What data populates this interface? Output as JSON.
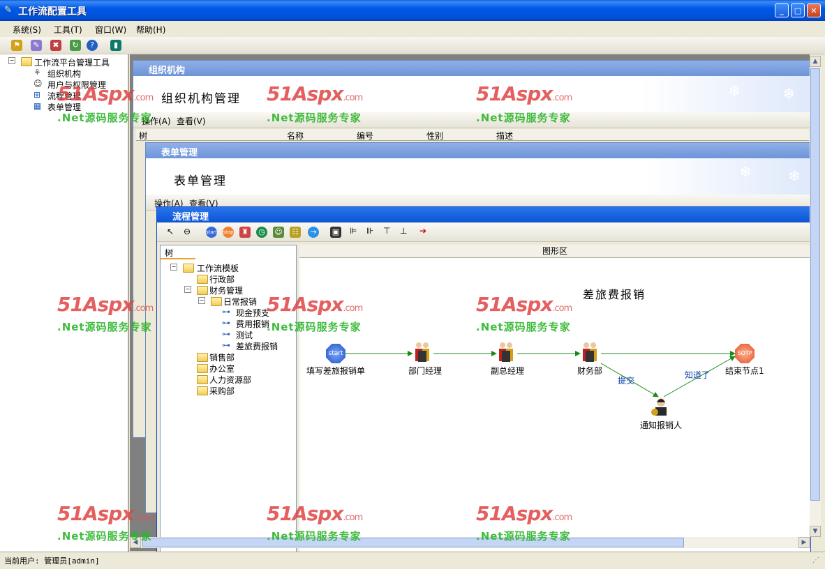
{
  "window": {
    "title": "工作流配置工具"
  },
  "menu": [
    "系统(S)",
    "工具(T)",
    "窗口(W)",
    "帮助(H)"
  ],
  "tree": {
    "root": "工作流平台管理工具",
    "items": [
      "组织机构",
      "用户与权限管理",
      "流程管理",
      "表单管理"
    ]
  },
  "org_window": {
    "title": "组织机构",
    "banner": "组织机构管理",
    "toolbar": {
      "operate": "操作(A)",
      "view": "查看(V)"
    },
    "tab": "树",
    "columns": [
      "名称",
      "编号",
      "性别",
      "描述"
    ]
  },
  "form_window": {
    "title": "表单管理",
    "banner": "表单管理",
    "toolbar": {
      "operate": "操作(A)",
      "view": "查看(V)"
    }
  },
  "flow_window": {
    "title": "流程管理",
    "tab_tree": "树",
    "tab_graph": "图形区",
    "tree": {
      "root": "工作流模板",
      "depts": [
        "行政部",
        "财务管理",
        "销售部",
        "办公室",
        "人力资源部",
        "采购部"
      ],
      "sub": "日常报销",
      "templates": [
        "现金预支",
        "费用报销",
        "测试",
        "差旅费报销"
      ]
    },
    "diagram": {
      "title": "差旅费报销",
      "nodes": [
        "填写差旅报销单",
        "部门经理",
        "副总经理",
        "财务部",
        "结束节点1",
        "通知报销人"
      ],
      "edge_labels": [
        "提交",
        "知道了"
      ],
      "start_icon": "start",
      "stop_icon": "SOTP"
    }
  },
  "watermark": {
    "brand": "51Aspx",
    "suffix": ".com",
    "tagline": ".Net源码服务专家"
  },
  "status": {
    "text": "当前用户: 管理员[admin]"
  },
  "colors": {
    "title_blue": "#0058e6",
    "flow_arrow": "#1a8a1a",
    "watermark_red": "#e04545",
    "watermark_green": "#2cb52c"
  }
}
